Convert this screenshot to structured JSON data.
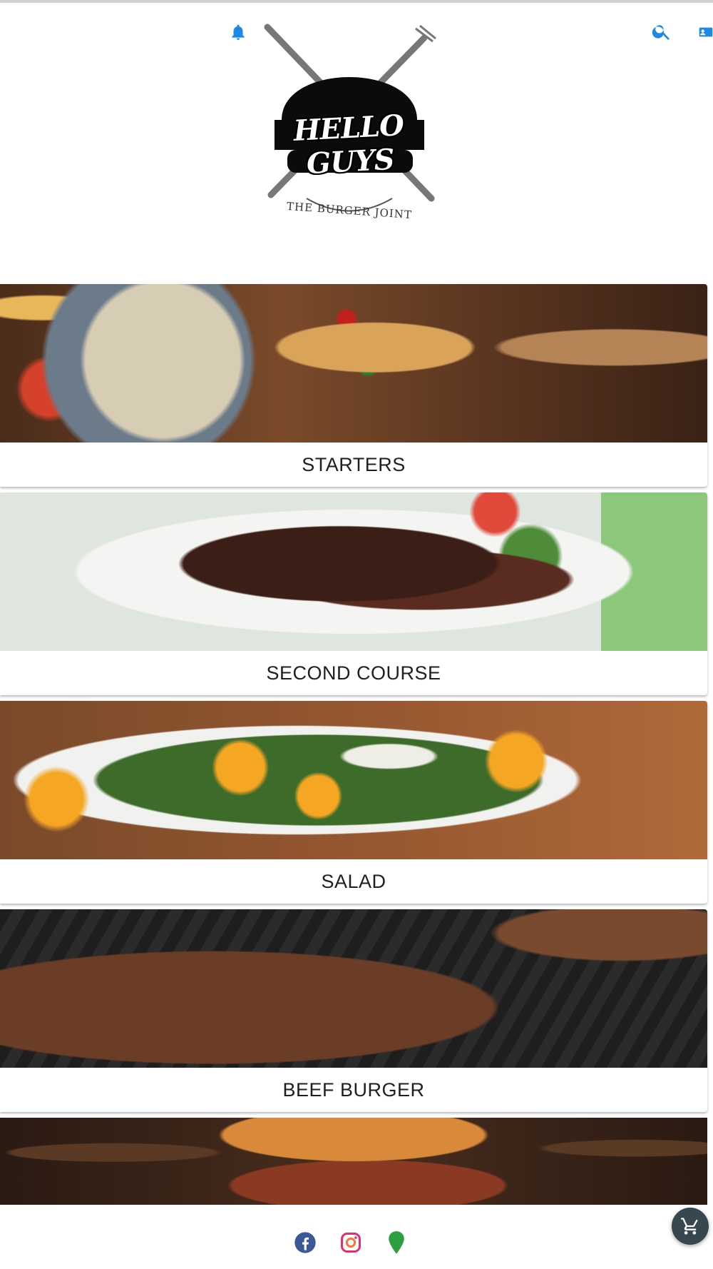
{
  "app": {
    "logo": {
      "name": "HELLO GUYS",
      "tagline": "THE BURGER JOINT"
    },
    "header_icons": [
      "notifications-icon",
      "search-icon",
      "contact-card-icon"
    ]
  },
  "colors": {
    "accent": "#1E88E5",
    "facebook": "#3B5998",
    "instagram": "#E1306C",
    "map_pin": "#2E9E3E",
    "cart_fab": "#37474F"
  },
  "categories": [
    {
      "label": "STARTERS"
    },
    {
      "label": "SECOND COURSE"
    },
    {
      "label": "SALAD"
    },
    {
      "label": "BEEF BURGER"
    },
    {
      "label": ""
    }
  ],
  "footer": {
    "icons": [
      "facebook-icon",
      "instagram-icon",
      "map-pin-icon"
    ]
  },
  "cart": {
    "icon": "cart-icon"
  }
}
